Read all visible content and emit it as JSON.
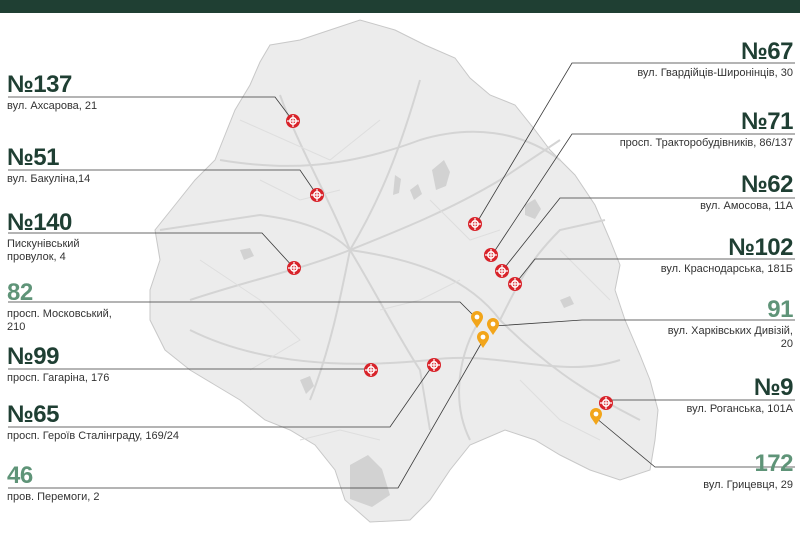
{
  "colors": {
    "header_bar": "#1f3f33",
    "number_dark": "#1f3f33",
    "number_light": "#5f9478",
    "map_fill": "#ececec",
    "road": "#d4d4d4",
    "water": "#d0d0d0",
    "leader_line": "#3a3a3a",
    "pin_red": "#d8232a",
    "pin_yellow": "#f2a51a"
  },
  "icons": {
    "red_marker": "red-circle-cross-marker",
    "yellow_marker": "yellow-map-pin"
  },
  "locations": [
    {
      "number": "№137",
      "address": "вул. Ахсарова, 21",
      "marker": "red"
    },
    {
      "number": "№51",
      "address": "вул. Бакуліна,14",
      "marker": "red"
    },
    {
      "number": "№140",
      "address": "Пискунівський провулок, 4",
      "marker": "red"
    },
    {
      "number": "82",
      "address": "просп. Московський, 210",
      "marker": "yellow"
    },
    {
      "number": "№99",
      "address": "просп. Гагаріна, 176",
      "marker": "red"
    },
    {
      "number": "№65",
      "address": "просп. Героїв Сталінграду, 169/24",
      "marker": "red"
    },
    {
      "number": "46",
      "address": "пров. Перемоги, 2",
      "marker": "yellow"
    },
    {
      "number": "№67",
      "address": "вул. Гвардійців-Широнінців, 30",
      "marker": "red"
    },
    {
      "number": "№71",
      "address": "просп. Тракторобудівників, 86/137",
      "marker": "red"
    },
    {
      "number": "№62",
      "address": "вул. Амосова, 11А",
      "marker": "red"
    },
    {
      "number": "№102",
      "address": "вул. Краснодарська, 181Б",
      "marker": "red"
    },
    {
      "number": "91",
      "address": "вул. Харківських Дивізій, 20",
      "marker": "yellow"
    },
    {
      "number": "№9",
      "address": "вул. Роганська, 101А",
      "marker": "red"
    },
    {
      "number": "172",
      "address": "вул. Грицевця, 29",
      "marker": "yellow"
    }
  ]
}
